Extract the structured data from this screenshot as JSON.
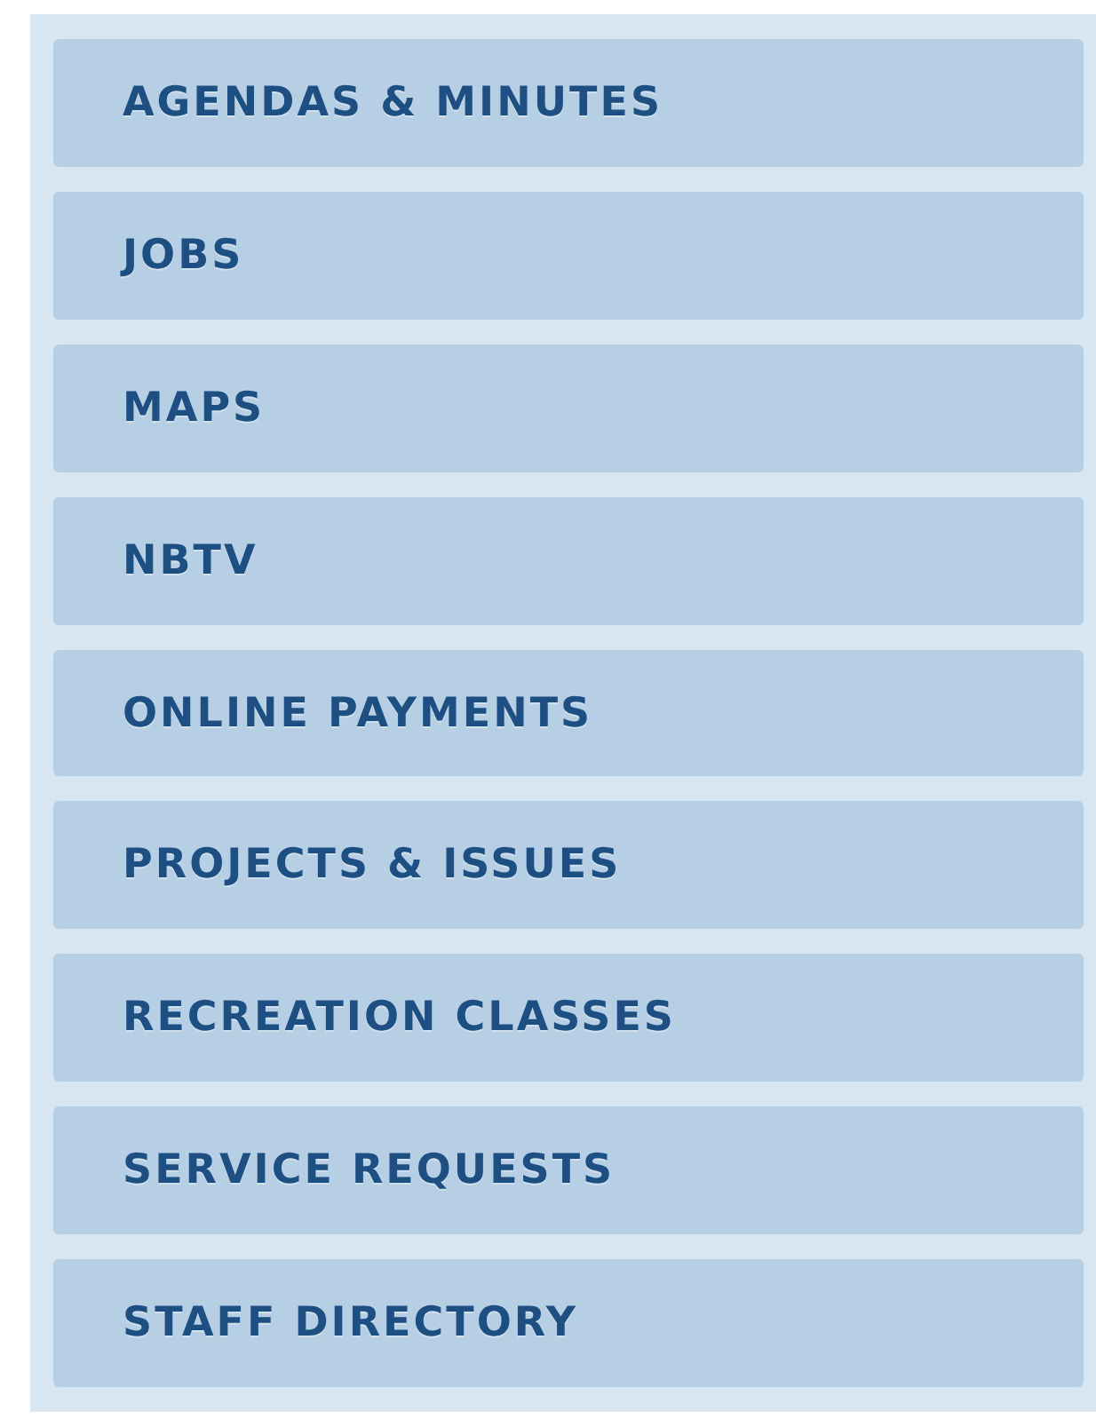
{
  "menu": {
    "items": [
      {
        "label": "AGENDAS & MINUTES"
      },
      {
        "label": "JOBS"
      },
      {
        "label": "MAPS"
      },
      {
        "label": "NBTV"
      },
      {
        "label": "ONLINE PAYMENTS"
      },
      {
        "label": "PROJECTS & ISSUES"
      },
      {
        "label": "RECREATION CLASSES"
      },
      {
        "label": "SERVICE REQUESTS"
      },
      {
        "label": "STAFF DIRECTORY"
      }
    ]
  }
}
